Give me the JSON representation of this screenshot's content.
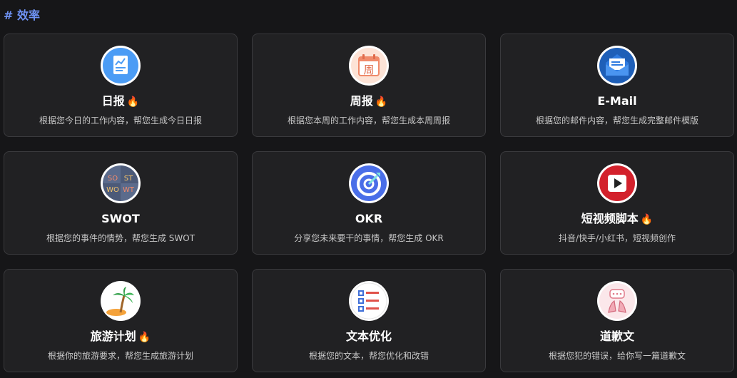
{
  "section": {
    "title": "# 效率"
  },
  "hot_badge": "🔥",
  "cards": [
    {
      "icon": "daily-report-icon",
      "title": "日报",
      "hot": true,
      "desc": "根据您今日的工作内容，帮您生成今日日报"
    },
    {
      "icon": "weekly-calendar-icon",
      "title": "周报",
      "hot": true,
      "desc": "根据您本周的工作内容，帮您生成本周周报"
    },
    {
      "icon": "mail-envelope-icon",
      "title": "E-Mail",
      "hot": false,
      "desc": "根据您的邮件内容，帮您生成完整邮件模版"
    },
    {
      "icon": "swot-grid-icon",
      "title": "SWOT",
      "hot": false,
      "desc": "根据您的事件的情势，帮您生成 SWOT"
    },
    {
      "icon": "target-icon",
      "title": "OKR",
      "hot": false,
      "desc": "分享您未来要干的事情，帮您生成 OKR"
    },
    {
      "icon": "video-play-icon",
      "title": "短视频脚本",
      "hot": true,
      "desc": "抖音/快手/小红书，短视频创作"
    },
    {
      "icon": "palm-island-icon",
      "title": "旅游计划",
      "hot": true,
      "desc": "根据你的旅游要求，帮您生成旅游计划"
    },
    {
      "icon": "list-document-icon",
      "title": "文本优化",
      "hot": false,
      "desc": "根据您的文本，帮您优化和改错"
    },
    {
      "icon": "apology-hands-icon",
      "title": "道歉文",
      "hot": false,
      "desc": "根据您犯的错误，给你写一篇道歉文"
    }
  ],
  "swot_letters": [
    "SO",
    "ST",
    "WO",
    "WT"
  ],
  "weekly_glyph": "周",
  "colors": {
    "accent": "#6f93f5",
    "card_bg": "#212123",
    "card_border": "#3a3a3d",
    "page_bg": "#161618"
  }
}
